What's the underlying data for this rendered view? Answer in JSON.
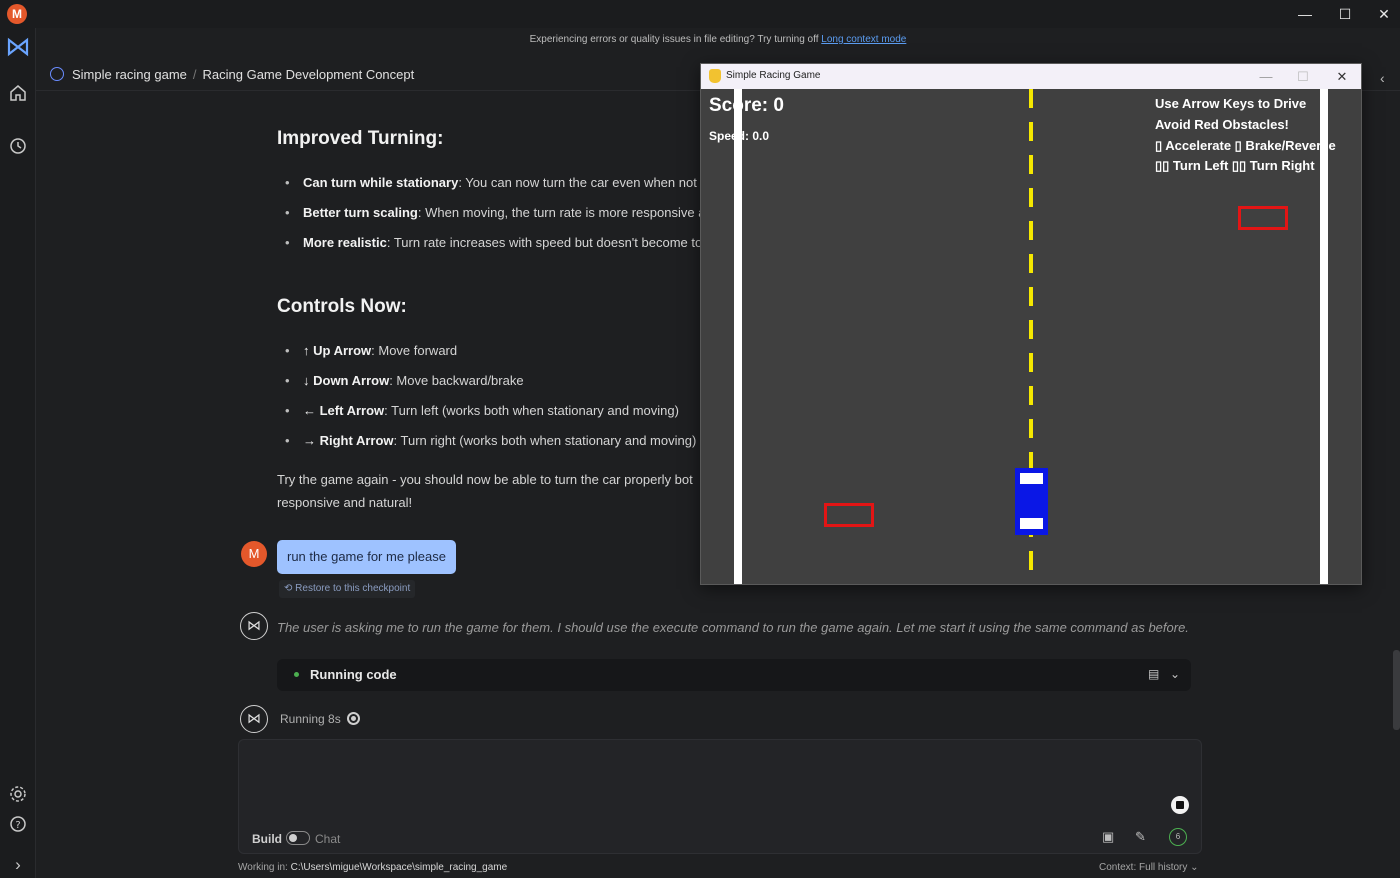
{
  "app": {
    "avatar_letter": "M",
    "window_controls": {
      "minimize": "—",
      "maximize": "☐",
      "close": "✕"
    }
  },
  "rail": {
    "logo_icon": "app-logo-icon",
    "items": [
      "home-icon",
      "history-icon"
    ],
    "bottom": [
      "settings-icon",
      "help-icon",
      "expand-icon"
    ]
  },
  "notice": {
    "text": "Experiencing errors or quality issues in file editing? Try turning off ",
    "link": "Long context mode"
  },
  "breadcrumb": {
    "project": "Simple racing game",
    "separator": "/",
    "thread": "Racing Game Development Concept"
  },
  "content": {
    "turning_heading": "Improved Turning:",
    "turning_items": [
      {
        "bold": "Can turn while stationary",
        "text": ": You can now turn the car even when not r"
      },
      {
        "bold": "Better turn scaling",
        "text": ": When moving, the turn rate is more responsive a"
      },
      {
        "bold": "More realistic",
        "text": ": Turn rate increases with speed but doesn't become to"
      }
    ],
    "controls_heading": "Controls Now:",
    "controls_items": [
      {
        "bold": "↑ Up Arrow",
        "text": ": Move forward"
      },
      {
        "bold": "↓ Down Arrow",
        "text": ": Move backward/brake"
      },
      {
        "bold": "← Left Arrow",
        "text": ": Turn left (works both when stationary and moving)"
      },
      {
        "bold": "→ Right Arrow",
        "text": ": Turn right (works both when stationary and moving)"
      }
    ],
    "closing_line1": "Try the game again - you should now be able to turn the car properly bot",
    "closing_line2": "responsive and natural!"
  },
  "chat": {
    "user_avatar": "M",
    "user_message": "run the game for me please",
    "restore_label": "⟲ Restore to this checkpoint",
    "thinking": "The user is asking me to run the game for them. I should use the execute command to run the game again. Let me start it using the same command as before.",
    "running_box_label": "Running code",
    "running_status": "Running 8s"
  },
  "composer": {
    "mode_build": "Build",
    "mode_chat": "Chat",
    "context_count": "6",
    "working_in_label": "Working in: ",
    "working_in_path": "C:\\Users\\migue\\Workspace\\simple_racing_game",
    "context_label": "Context: Full history ⌄"
  },
  "game_window": {
    "title": "Simple Racing Game",
    "controls": {
      "minimize": "—",
      "maximize": "☐",
      "close": "✕"
    },
    "score": "Score: 0",
    "speed": "Speed: 0.0",
    "instructions": [
      "Use Arrow Keys to Drive",
      "Avoid Red Obstacles!",
      "▯ Accelerate  ▯ Brake/Reverse",
      "▯▯ Turn Left  ▯▯ Turn Right"
    ],
    "colors": {
      "road": "#404040",
      "lane": "#f5e800",
      "car": "#0a17e6",
      "obstacle": "#e31515"
    }
  }
}
